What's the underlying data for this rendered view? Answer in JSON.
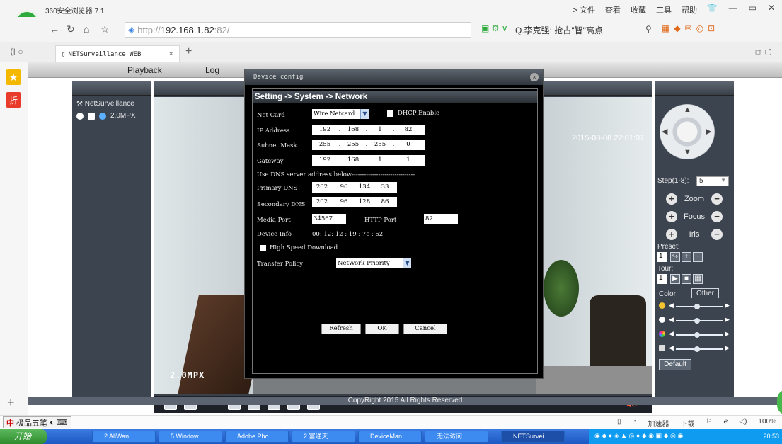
{
  "browser": {
    "app_title": "360安全浏览器 7.1",
    "menu": [
      "> 文件",
      "查看",
      "收藏",
      "工具",
      "帮助"
    ],
    "url_prefix": "http://",
    "url_host": "192.168.1.82",
    "url_port": ":82/",
    "search_text": "Q.李克强: 抢占\"智\"高点",
    "tab_title": "NETSurveillance WEB",
    "tab_close": "×",
    "tab_new": "+"
  },
  "page": {
    "nav": [
      "Playback",
      "Log"
    ],
    "device_name": "NetSurveillance",
    "device_stream": "2.0MPX",
    "video_label": "2.0MPX",
    "video_timestamp": "2015-08-08 22:01:07",
    "footer": "CopyRight 2015 All Rights Reserved"
  },
  "ptz": {
    "step_label": "Step(1-8):",
    "step_value": "5",
    "zoom": "Zoom",
    "focus": "Focus",
    "iris": "Iris",
    "preset_label": "Preset:",
    "preset_value": "1",
    "tour_label": "Tour:",
    "tour_value": "1",
    "tab_color": "Color",
    "tab_other": "Other",
    "default_btn": "Default"
  },
  "dialog": {
    "title": "Device config",
    "breadcrumb": "Setting -> System -> Network",
    "net_card_label": "Net Card",
    "net_card_value": "Wire Netcard",
    "dhcp_label": "DHCP Enable",
    "ip_label": "IP Address",
    "ip": [
      "192",
      "168",
      "1",
      "82"
    ],
    "mask_label": "Subnet Mask",
    "mask": [
      "255",
      "255",
      "255",
      "0"
    ],
    "gateway_label": "Gateway",
    "gateway": [
      "192",
      "168",
      "1",
      "1"
    ],
    "dns_heading": "Use DNS server address below-------------------------------",
    "primary_dns_label": "Primary DNS",
    "primary_dns": [
      "202",
      "96",
      "134",
      "33"
    ],
    "secondary_dns_label": "Secondary DNS",
    "secondary_dns": [
      "202",
      "96",
      "128",
      "86"
    ],
    "media_port_label": "Media Port",
    "media_port": "34567",
    "http_port_label": "HTTP Port",
    "http_port": "82",
    "device_info_label": "Device Info",
    "device_info": "00: 12: 12 : 19 : 7c : 62",
    "high_speed_label": "High Speed Download",
    "transfer_label": "Transfer Policy",
    "transfer_value": "NetWork Priority",
    "btn_refresh": "Refresh",
    "btn_ok": "OK",
    "btn_cancel": "Cancel"
  },
  "statusbar": {
    "ime": "极品五笔",
    "items": [
      "加速器",
      "下载",
      "100%"
    ]
  },
  "taskbar": {
    "start": "开始",
    "tasks": [
      "2 AliWan...",
      "5 Window...",
      "Adobe Pho...",
      "2 富通天...",
      "DeviceMan...",
      "无法访问 ...",
      "NETSurvei..."
    ],
    "clock": "20:53"
  }
}
